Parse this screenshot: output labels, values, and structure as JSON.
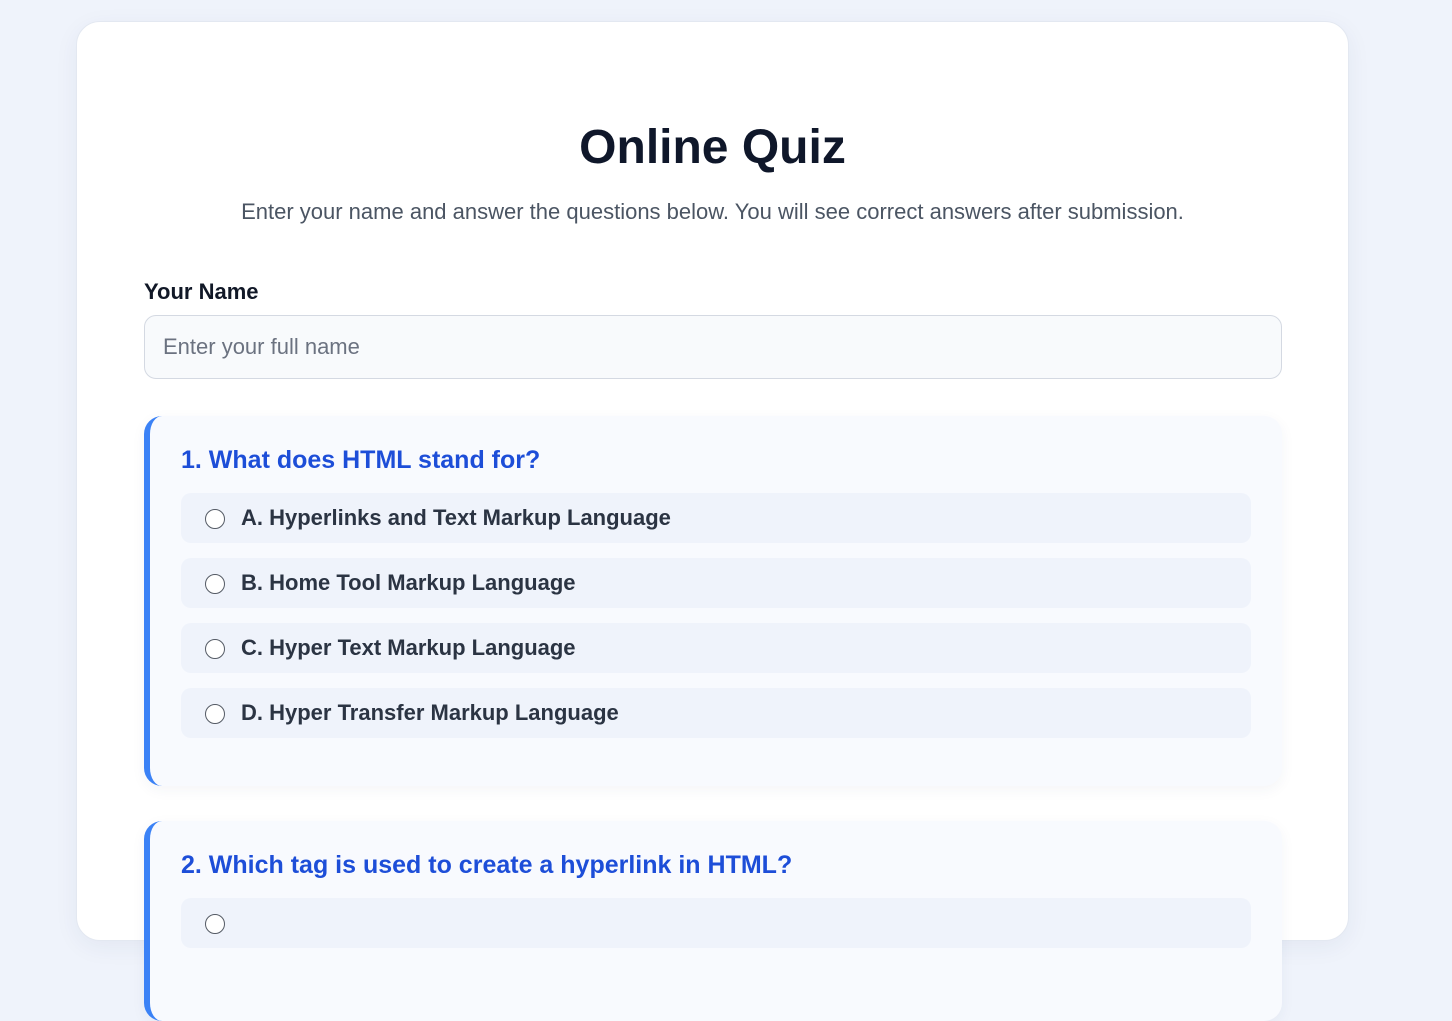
{
  "header": {
    "title": "Online Quiz",
    "subtitle": "Enter your name and answer the questions below. You will see correct answers after submission."
  },
  "name_field": {
    "label": "Your Name",
    "placeholder": "Enter your full name",
    "value": ""
  },
  "questions": [
    {
      "text": "1. What does HTML stand for?",
      "options": [
        "A. Hyperlinks and Text Markup Language",
        "B. Home Tool Markup Language",
        "C. Hyper Text Markup Language",
        "D. Hyper Transfer Markup Language"
      ]
    },
    {
      "text": "2. Which tag is used to create a hyperlink in HTML?",
      "options": []
    }
  ],
  "colors": {
    "accent": "#3b82f6",
    "question_text": "#1d4ed8",
    "page_background": "#eff3fb"
  }
}
